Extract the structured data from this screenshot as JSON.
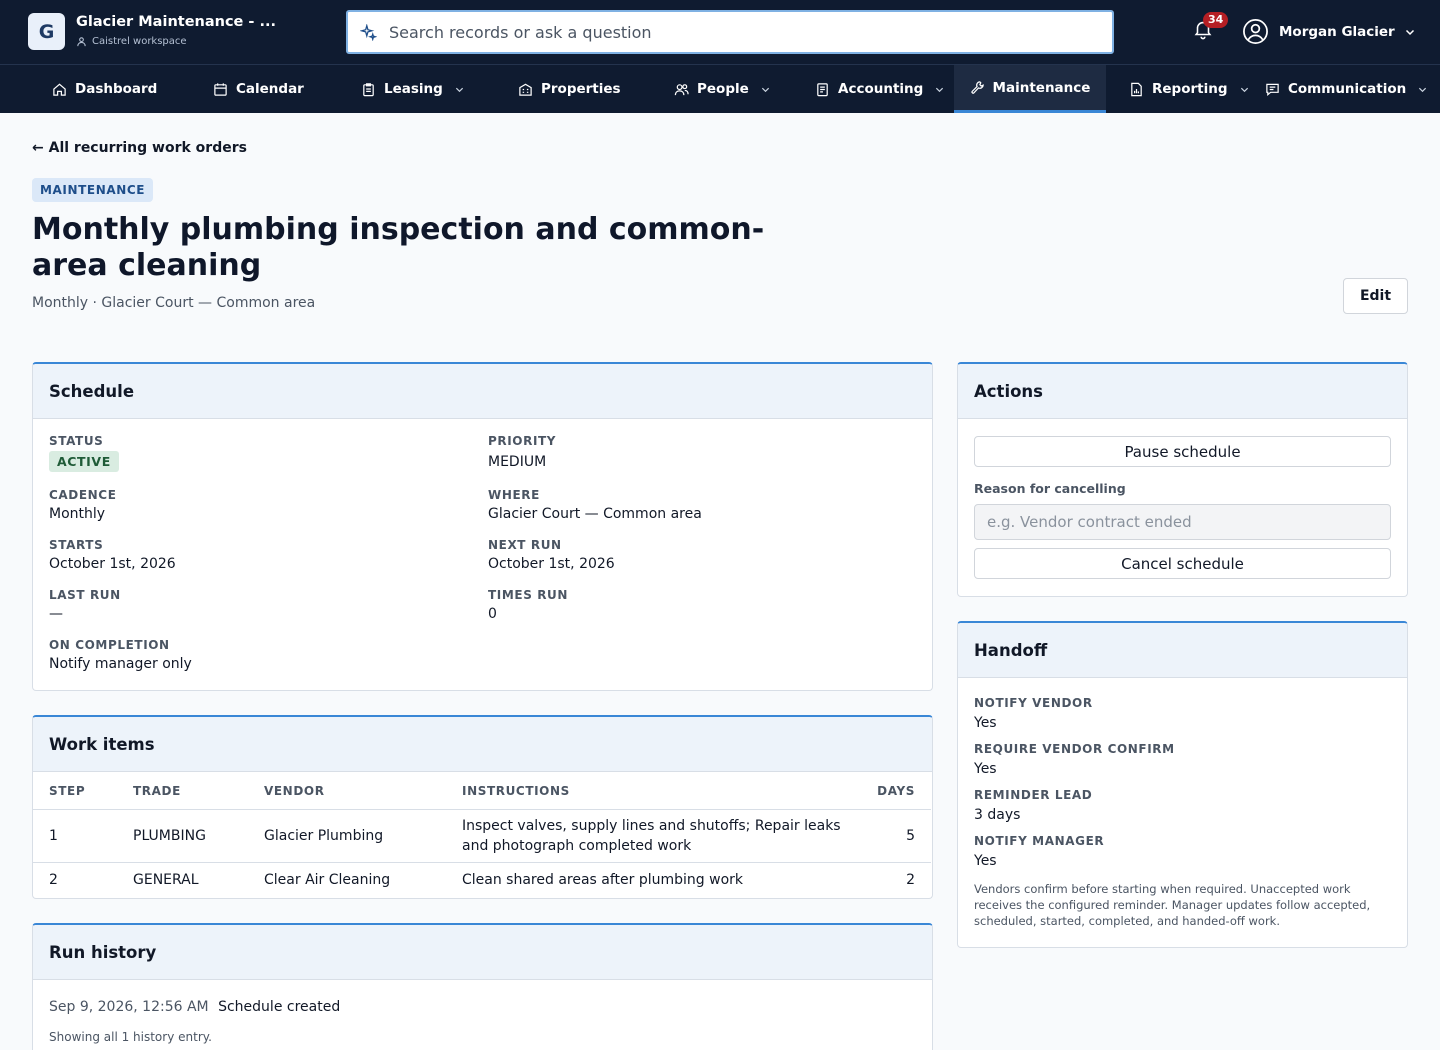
{
  "app": {
    "logo_letter": "G",
    "title": "Glacier Maintenance - ...",
    "workspace": "Caistrel workspace"
  },
  "search": {
    "placeholder": "Search records or ask a question",
    "value": ""
  },
  "notifications": {
    "count": "34"
  },
  "user": {
    "name": "Morgan Glacier"
  },
  "nav": {
    "items": [
      {
        "label": "Dashboard",
        "icon": "home-icon",
        "dropdown": false
      },
      {
        "label": "Calendar",
        "icon": "calendar-icon",
        "dropdown": false
      },
      {
        "label": "Leasing",
        "icon": "clipboard-icon",
        "dropdown": true
      },
      {
        "label": "Properties",
        "icon": "building-icon",
        "dropdown": false
      },
      {
        "label": "People",
        "icon": "people-icon",
        "dropdown": true
      },
      {
        "label": "Accounting",
        "icon": "ledger-icon",
        "dropdown": true
      },
      {
        "label": "Maintenance",
        "icon": "wrench-icon",
        "dropdown": false,
        "active": true
      },
      {
        "label": "Reporting",
        "icon": "report-icon",
        "dropdown": true
      },
      {
        "label": "Communication",
        "icon": "message-icon",
        "dropdown": true
      }
    ]
  },
  "header": {
    "back_link": "← All recurring work orders",
    "tag": "MAINTENANCE",
    "title": "Monthly plumbing inspection and common-area cleaning",
    "subtitle": "Monthly · Glacier Court — Common area",
    "edit_label": "Edit"
  },
  "schedule": {
    "heading": "Schedule",
    "status_label": "STATUS",
    "status_value": "ACTIVE",
    "priority_label": "PRIORITY",
    "priority_value": "MEDIUM",
    "cadence_label": "CADENCE",
    "cadence_value": "Monthly",
    "where_label": "WHERE",
    "where_value": "Glacier Court — Common area",
    "starts_label": "STARTS",
    "starts_value": "October 1st, 2026",
    "next_run_label": "NEXT RUN",
    "next_run_value": "October 1st, 2026",
    "last_run_label": "LAST RUN",
    "last_run_value": "—",
    "times_run_label": "TIMES RUN",
    "times_run_value": "0",
    "on_completion_label": "ON COMPLETION",
    "on_completion_value": "Notify manager only"
  },
  "work_items": {
    "heading": "Work items",
    "columns": [
      "STEP",
      "TRADE",
      "VENDOR",
      "INSTRUCTIONS",
      "DAYS"
    ],
    "rows": [
      {
        "step": "1",
        "trade": "PLUMBING",
        "vendor": "Glacier Plumbing",
        "instructions": "Inspect valves, supply lines and shutoffs; Repair leaks and photograph completed work",
        "days": "5"
      },
      {
        "step": "2",
        "trade": "GENERAL",
        "vendor": "Clear Air Cleaning",
        "instructions": "Clean shared areas after plumbing work",
        "days": "2"
      }
    ]
  },
  "run_history": {
    "heading": "Run history",
    "entries": [
      {
        "time": "Sep 9, 2026, 12:56 AM",
        "text": "Schedule created"
      }
    ],
    "footer": "Showing all 1 history entry."
  },
  "actions": {
    "heading": "Actions",
    "pause_label": "Pause schedule",
    "reason_label": "Reason for cancelling",
    "reason_placeholder": "e.g. Vendor contract ended",
    "cancel_label": "Cancel schedule"
  },
  "handoff": {
    "heading": "Handoff",
    "notify_vendor_label": "NOTIFY VENDOR",
    "notify_vendor_value": "Yes",
    "require_confirm_label": "REQUIRE VENDOR CONFIRM",
    "require_confirm_value": "Yes",
    "reminder_lead_label": "REMINDER LEAD",
    "reminder_lead_value": "3 days",
    "notify_manager_label": "NOTIFY MANAGER",
    "notify_manager_value": "Yes",
    "note": "Vendors confirm before starting when required. Unaccepted work receives the configured reminder. Manager updates follow accepted, scheduled, started, completed, and handed-off work."
  },
  "colors": {
    "topbar": "#0f1b30",
    "accent": "#3a87d6",
    "panel_header": "#edf3fa",
    "status_bg": "#d9ece1",
    "badge": "#b51f24"
  }
}
